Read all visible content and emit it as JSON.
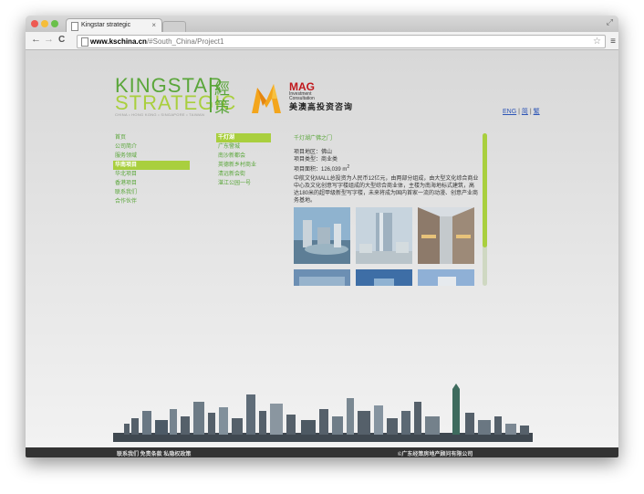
{
  "browser": {
    "tab_title": "Kingstar strategic",
    "tab_close": "×",
    "url_domain": "www.kschina.cn",
    "url_path": "/#South_China/Project1",
    "back": "←",
    "forward": "→",
    "reload": "C",
    "star": "☆",
    "menu": "≡",
    "expand": "⤢",
    "traffic_colors": [
      "#ee5a52",
      "#f5bd39",
      "#6ac04a"
    ]
  },
  "header": {
    "logo_line1": "KINGSTAR",
    "logo_line2": "STRATEGIC",
    "logo_tagline": "CHINA • HONG KONG • SINGAPORE • TAIWAN",
    "logo_cn1": "經",
    "logo_cn2": "策",
    "mag_title": "MAG",
    "mag_sub1": "Investment",
    "mag_sub2": "Consultation",
    "mag_cn": "美澳高投资咨询",
    "lang_eng": "ENG",
    "lang_sep": "|",
    "lang_zh_simplified": "简",
    "lang_zh_traditional": "繁",
    "brand_green": "#5aa63a",
    "brand_lime": "#a9cf3e",
    "mag_red": "#c0171c"
  },
  "left_nav": {
    "items": [
      {
        "label": "首页",
        "active": false
      },
      {
        "label": "公司简介",
        "active": false
      },
      {
        "label": "服务领域",
        "active": false
      },
      {
        "label": "华南项目",
        "active": true
      },
      {
        "label": "华北项目",
        "active": false
      },
      {
        "label": "香港项目",
        "active": false
      },
      {
        "label": "联系我们",
        "active": false
      },
      {
        "label": "合作伙伴",
        "active": false
      }
    ]
  },
  "sub_nav": {
    "items": [
      {
        "label": "千灯湖",
        "active": true
      },
      {
        "label": "广东警城",
        "active": false
      },
      {
        "label": "南沙新都会",
        "active": false
      },
      {
        "label": "英德新乡村商业",
        "active": false
      },
      {
        "label": "清远新会街",
        "active": false
      },
      {
        "label": "湛江公园一号",
        "active": false
      }
    ]
  },
  "project": {
    "title": "千灯湖广佛之门",
    "location": "项目地区：佛山",
    "type": "项目类型：商业类",
    "area": "项目面积：126,039 m",
    "area_sup": "2",
    "description": "中航文化MALL总投资为人民币12亿元，由两部分组成，由大型文化综合商业中心及文化创意写字楼组成的大型综合商业体，主楼为南海地标式建筑，高达180米的超甲级新型写字楼，未来将成为国内首家一流的动漫、创意产业商务基地。"
  },
  "footer": {
    "links": "联系我们 免责条款 私隐权政策",
    "copyright": "©广东经策房地产顾问有限公司"
  }
}
